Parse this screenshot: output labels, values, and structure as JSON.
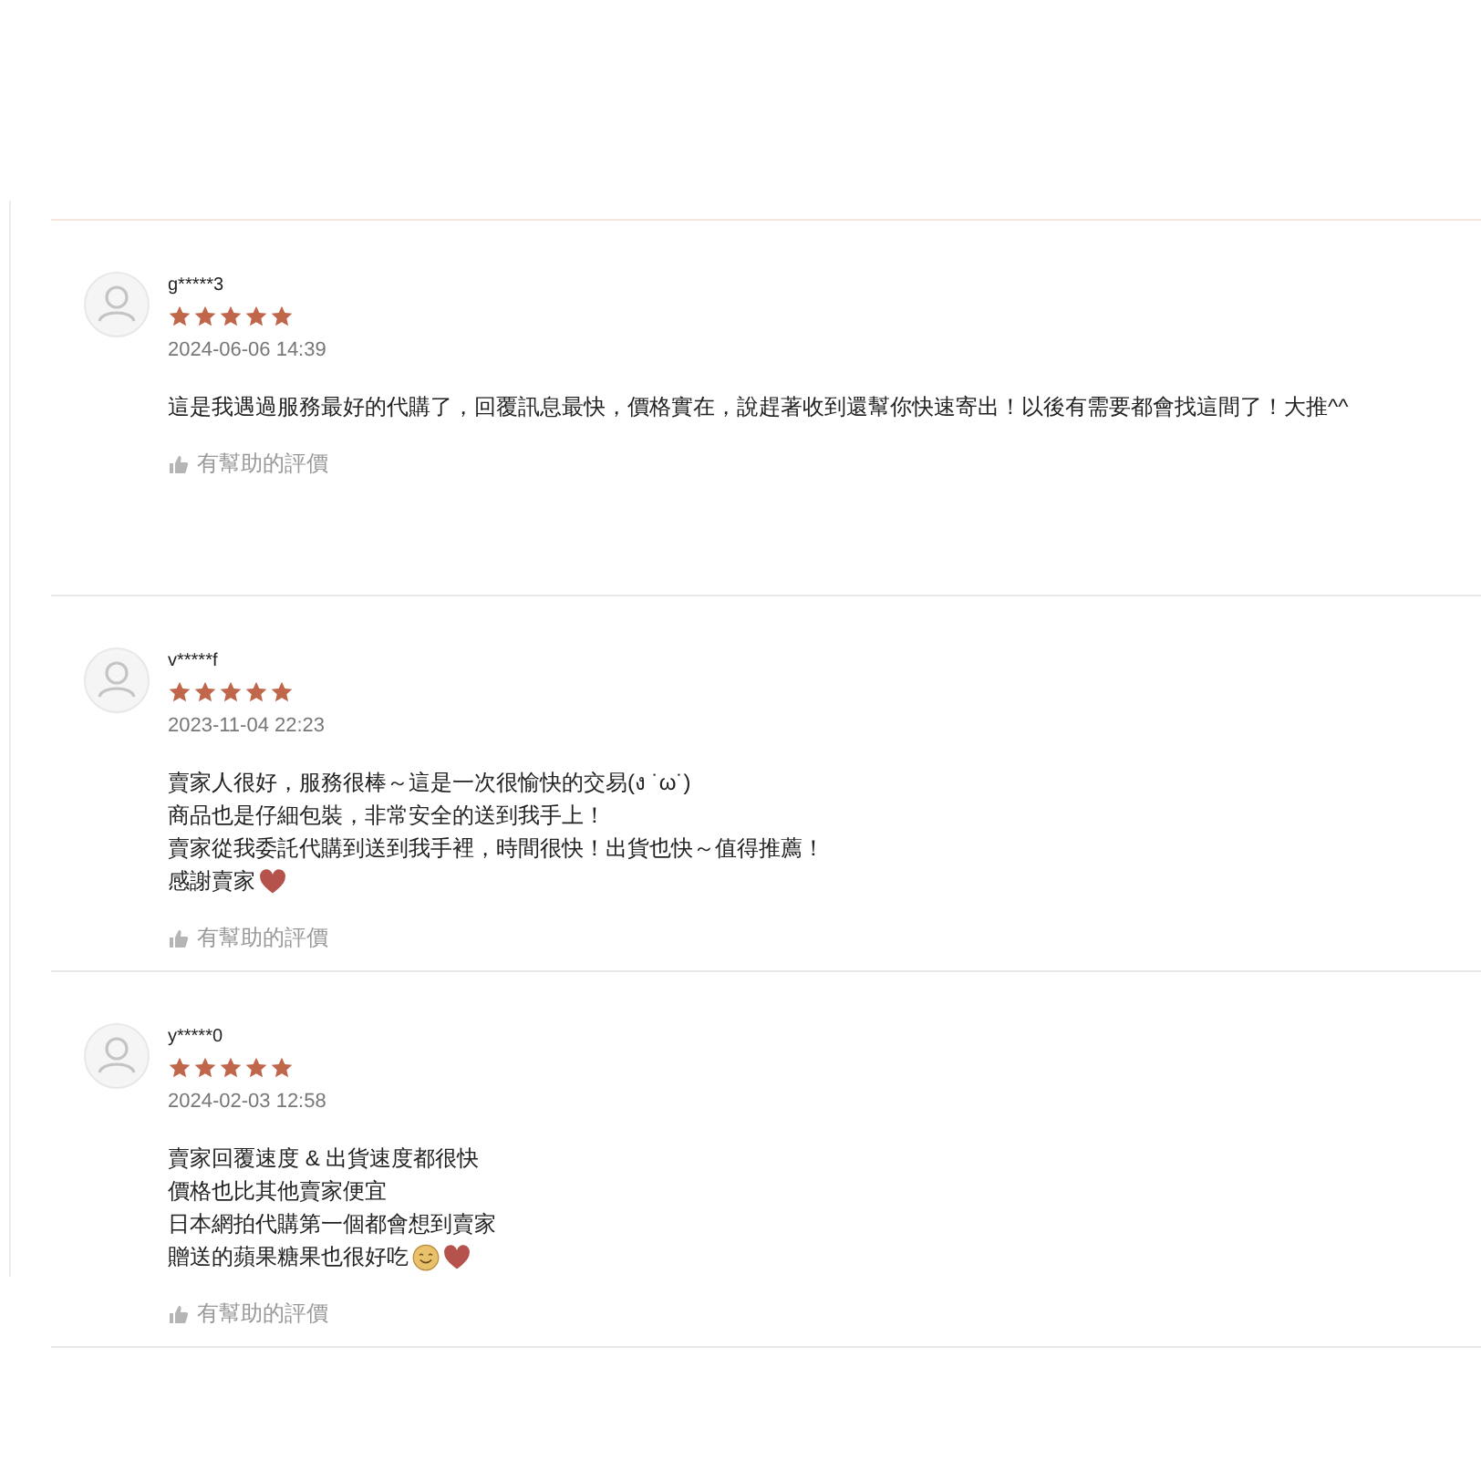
{
  "reviews": [
    {
      "user": "g*****3",
      "stars": 5,
      "date": "2024-06-06 14:39",
      "lines": [
        {
          "text": "這是我遇過服務最好的代購了，回覆訊息最快，價格實在，說趕著收到還幫你快速寄出！以後有需要都會找這間了！大推^^",
          "kind": "plain"
        }
      ],
      "helpful": "有幫助的評價"
    },
    {
      "user": "v*****f",
      "stars": 5,
      "date": "2023-11-04 22:23",
      "lines": [
        {
          "text": "賣家人很好，服務很棒～這是一次很愉快的交易(ง ˙ω˙)",
          "kind": "plain"
        },
        {
          "text": "商品也是仔細包裝，非常安全的送到我手上！",
          "kind": "plain"
        },
        {
          "text": "賣家從我委託代購到送到我手裡，時間很快！出貨也快～值得推薦！",
          "kind": "plain"
        },
        {
          "text": "感謝賣家",
          "kind": "heart"
        }
      ],
      "helpful": "有幫助的評價"
    },
    {
      "user": "y*****0",
      "stars": 5,
      "date": "2024-02-03 12:58",
      "lines": [
        {
          "text": "賣家回覆速度 & 出貨速度都很快",
          "kind": "plain"
        },
        {
          "text": "價格也比其他賣家便宜",
          "kind": "plain"
        },
        {
          "text": "日本網拍代購第一個都會想到賣家",
          "kind": "plain"
        },
        {
          "text": "贈送的蘋果糖果也很好吃",
          "kind": "smile_heart"
        }
      ],
      "helpful": "有幫助的評價"
    }
  ]
}
